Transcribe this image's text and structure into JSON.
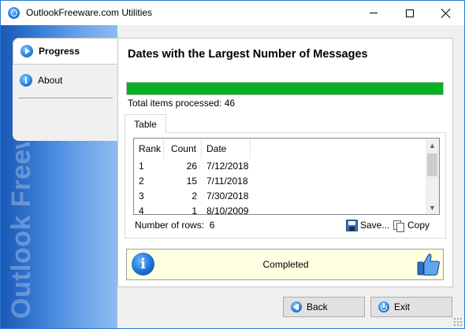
{
  "window": {
    "title": "OutlookFreeware.com Utilities"
  },
  "sidebar": {
    "items": [
      {
        "label": "Progress",
        "icon": "play-icon",
        "selected": true
      },
      {
        "label": "About",
        "icon": "info-icon",
        "selected": false
      }
    ],
    "brand_text": "Outlook Freeware.com"
  },
  "main": {
    "heading": "Dates with the Largest Number of Messages",
    "progress": {
      "percent": 100,
      "color": "#06b025"
    },
    "items_processed_text": "Total items processed: 46",
    "tab_label": "Table",
    "table": {
      "columns": [
        "Rank",
        "Count",
        "Date"
      ],
      "rows": [
        [
          "1",
          "26",
          "7/12/2018"
        ],
        [
          "2",
          "15",
          "7/11/2018"
        ],
        [
          "3",
          "2",
          "7/30/2018"
        ],
        [
          "4",
          "1",
          "8/10/2009"
        ]
      ]
    },
    "row_count_label": "Number of rows:",
    "row_count_value": "6",
    "save_label": "Save...",
    "copy_label": "Copy",
    "status_text": "Completed"
  },
  "footer": {
    "back_label": "Back",
    "exit_label": "Exit"
  },
  "colors": {
    "accent": "#2b79d6",
    "progress_fill": "#06b025",
    "status_bg": "#ffffe1"
  }
}
